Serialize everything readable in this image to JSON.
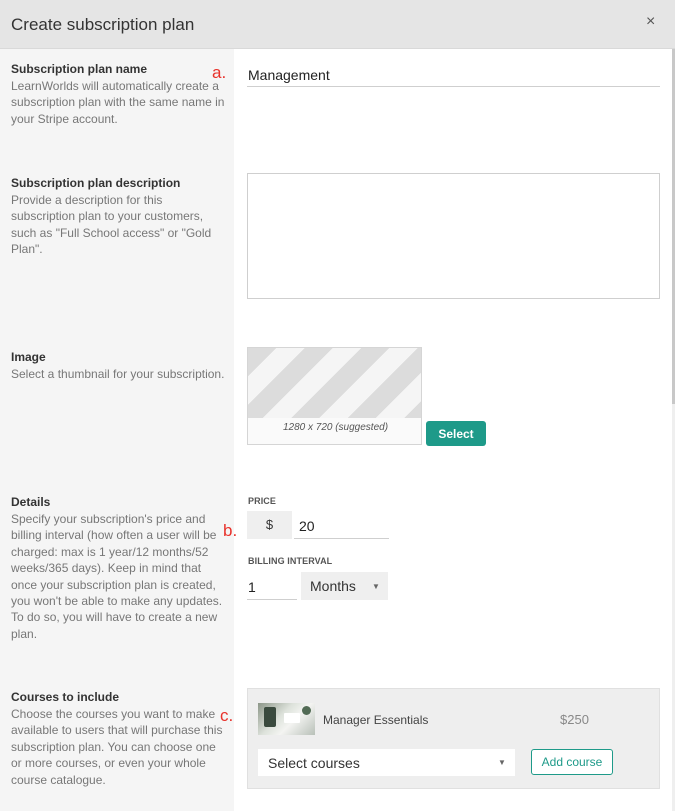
{
  "dialog": {
    "title": "Create subscription plan",
    "close_symbol": "×"
  },
  "sections": {
    "name": {
      "title": "Subscription plan name",
      "description_lines": [
        "LearnWorlds will automatically create a",
        "subscription plan with the same name in",
        "your Stripe account."
      ],
      "marker": "a.",
      "value": "Management"
    },
    "description": {
      "title": "Subscription plan description",
      "description_lines": [
        "Provide a description for this",
        "subscription plan to your customers,",
        "such as \"Full School access\" or \"Gold",
        "Plan\"."
      ],
      "value": ""
    },
    "image": {
      "title": "Image",
      "description_lines": [
        "Select a thumbnail for your subscription."
      ],
      "thumbnail_caption": "1280 x 720 (suggested)",
      "select_label": "Select"
    },
    "details": {
      "title": "Details",
      "description_lines": [
        "Specify your subscription's price and",
        "billing interval (how often a user will be",
        "charged: max is 1 year/12 months/52",
        "weeks/365 days). Keep in mind that",
        "once your subscription plan is created,",
        "you won't be able to make any updates.",
        "To do so, you will have to create a new",
        "plan."
      ],
      "marker": "b.",
      "price_label": "PRICE",
      "currency_symbol": "$",
      "price_value": "20",
      "interval_label": "BILLING INTERVAL",
      "interval_value": "1",
      "interval_unit": "Months"
    },
    "courses": {
      "title": "Courses to include",
      "description_lines": [
        "Choose the courses you want to make",
        "available to users that will purchase this",
        "subscription plan. You can choose one",
        "or more courses, or even your whole",
        "course catalogue."
      ],
      "marker": "c.",
      "items": [
        {
          "name": "Manager Essentials",
          "price": "$250"
        }
      ],
      "select_placeholder": "Select courses",
      "add_label": "Add course"
    }
  }
}
